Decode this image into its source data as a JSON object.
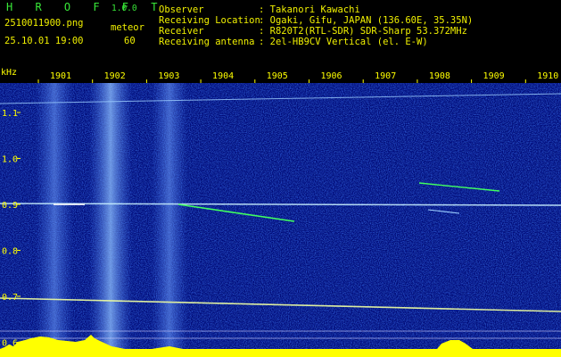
{
  "header": {
    "app_name": "H R O F F T",
    "version": "1.0.0",
    "filename": "2510011900.png",
    "detection_label": "meteor",
    "datetime": "25.10.01 19:00",
    "detection_count": "60",
    "fields": [
      {
        "label": "Observer",
        "value": ": Takanori Kawachi"
      },
      {
        "label": "Receiving Location",
        "value": ": Ogaki, Gifu, JAPAN (136.60E, 35.35N)"
      },
      {
        "label": "Receiver",
        "value": ": R820T2(RTL-SDR) SDR-Sharp 53.372MHz"
      },
      {
        "label": "Receiving antenna",
        "value": ": 2el-HB9CV Vertical (el. E-W)"
      }
    ]
  },
  "spectrogram": {
    "unit_label": "kHz",
    "time_labels": [
      "1901",
      "1902",
      "1903",
      "1904",
      "1905",
      "1906",
      "1907",
      "1908",
      "1909",
      "1910"
    ],
    "freq_labels": [
      "1.1",
      "1.0",
      "0.9",
      "0.8",
      "0.7",
      "0.6"
    ],
    "colors": {
      "background": "#000a78",
      "noise": "#1c3cc0",
      "signal": "#ffffff",
      "meteor": "#40ff60",
      "baseline": "#ffff00"
    }
  }
}
